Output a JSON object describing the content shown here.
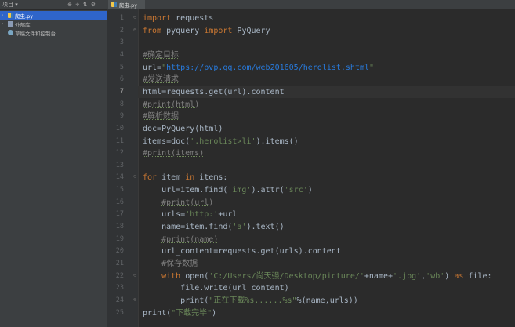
{
  "sidebar": {
    "toolbar_title": "项目 ▾",
    "toolbar_icons": [
      "⊕",
      "≑",
      "⇅",
      "⚙",
      "—"
    ],
    "items": [
      {
        "arrow": "›",
        "label": "爬虫.py",
        "selected": true,
        "icon": "python-file-icon"
      },
      {
        "arrow": "›",
        "label": "外部库",
        "selected": false,
        "icon": "library-icon"
      },
      {
        "arrow": "",
        "label": "草稿文件和控制台",
        "selected": false,
        "icon": "scratch-icon"
      }
    ]
  },
  "editor": {
    "tab_label": "爬虫.py",
    "current_line": 7,
    "lines": [
      {
        "n": "1",
        "fold": "⊖",
        "tokens": [
          {
            "t": "kw",
            "v": "import"
          },
          {
            "t": "",
            "v": " requests"
          }
        ]
      },
      {
        "n": "2",
        "fold": "⊖",
        "tokens": [
          {
            "t": "kw",
            "v": "from"
          },
          {
            "t": "",
            "v": " pyquery "
          },
          {
            "t": "kw",
            "v": "import"
          },
          {
            "t": "",
            "v": " PyQuery"
          }
        ]
      },
      {
        "n": "3",
        "fold": "",
        "tokens": []
      },
      {
        "n": "4",
        "fold": "",
        "tokens": [
          {
            "t": "cm ul",
            "v": "#确定目标"
          }
        ]
      },
      {
        "n": "5",
        "fold": "",
        "tokens": [
          {
            "t": "",
            "v": "url="
          },
          {
            "t": "str",
            "v": "\""
          },
          {
            "t": "url",
            "v": "https://pvp.qq.com/web201605/herolist.shtml"
          },
          {
            "t": "str",
            "v": "\""
          }
        ]
      },
      {
        "n": "6",
        "fold": "",
        "tokens": [
          {
            "t": "cm ul",
            "v": "#发送请求"
          }
        ]
      },
      {
        "n": "7",
        "fold": "",
        "tokens": [
          {
            "t": "",
            "v": "html=requests.get(url).content"
          }
        ]
      },
      {
        "n": "8",
        "fold": "",
        "tokens": [
          {
            "t": "cm ul",
            "v": "#print(html)"
          }
        ]
      },
      {
        "n": "9",
        "fold": "",
        "tokens": [
          {
            "t": "cm ul",
            "v": "#解析数据"
          }
        ]
      },
      {
        "n": "10",
        "fold": "",
        "tokens": [
          {
            "t": "",
            "v": "doc=PyQuery(html)"
          }
        ]
      },
      {
        "n": "11",
        "fold": "",
        "tokens": [
          {
            "t": "",
            "v": "items=doc("
          },
          {
            "t": "str",
            "v": "'.herolist>li'"
          },
          {
            "t": "",
            "v": ").items()"
          }
        ]
      },
      {
        "n": "12",
        "fold": "",
        "tokens": [
          {
            "t": "cm ul",
            "v": "#print(items)"
          }
        ]
      },
      {
        "n": "13",
        "fold": "",
        "tokens": []
      },
      {
        "n": "14",
        "fold": "⊖",
        "tokens": [
          {
            "t": "kw",
            "v": "for"
          },
          {
            "t": "",
            "v": " item "
          },
          {
            "t": "kw",
            "v": "in"
          },
          {
            "t": "",
            "v": " items:"
          }
        ]
      },
      {
        "n": "15",
        "fold": "",
        "tokens": [
          {
            "t": "",
            "v": "    url=item.find("
          },
          {
            "t": "str",
            "v": "'img'"
          },
          {
            "t": "",
            "v": ").attr("
          },
          {
            "t": "str",
            "v": "'src'"
          },
          {
            "t": "",
            "v": ")"
          }
        ]
      },
      {
        "n": "16",
        "fold": "",
        "tokens": [
          {
            "t": "",
            "v": "    "
          },
          {
            "t": "cm ul",
            "v": "#print(url)"
          }
        ]
      },
      {
        "n": "17",
        "fold": "",
        "tokens": [
          {
            "t": "",
            "v": "    urls="
          },
          {
            "t": "str",
            "v": "'http:'"
          },
          {
            "t": "",
            "v": "+url"
          }
        ]
      },
      {
        "n": "18",
        "fold": "",
        "tokens": [
          {
            "t": "",
            "v": "    name=item.find("
          },
          {
            "t": "str",
            "v": "'a'"
          },
          {
            "t": "",
            "v": ").text()"
          }
        ]
      },
      {
        "n": "19",
        "fold": "",
        "tokens": [
          {
            "t": "",
            "v": "    "
          },
          {
            "t": "cm ul",
            "v": "#print(name)"
          }
        ]
      },
      {
        "n": "20",
        "fold": "",
        "tokens": [
          {
            "t": "",
            "v": "    url_content=requests.get(urls).content"
          }
        ]
      },
      {
        "n": "21",
        "fold": "",
        "tokens": [
          {
            "t": "",
            "v": "    "
          },
          {
            "t": "cm ul",
            "v": "#保存数据"
          }
        ]
      },
      {
        "n": "22",
        "fold": "⊖",
        "tokens": [
          {
            "t": "",
            "v": "    "
          },
          {
            "t": "kw",
            "v": "with"
          },
          {
            "t": "",
            "v": " open("
          },
          {
            "t": "str",
            "v": "'C:/Users/尚天强/Desktop/picture/'"
          },
          {
            "t": "",
            "v": "+name+"
          },
          {
            "t": "str",
            "v": "'.jpg'"
          },
          {
            "t": "",
            "v": ","
          },
          {
            "t": "str",
            "v": "'wb'"
          },
          {
            "t": "",
            "v": ") "
          },
          {
            "t": "kw",
            "v": "as"
          },
          {
            "t": "",
            "v": " file:"
          }
        ]
      },
      {
        "n": "23",
        "fold": "",
        "tokens": [
          {
            "t": "",
            "v": "        file.write(url_content)"
          }
        ]
      },
      {
        "n": "24",
        "fold": "⊖",
        "tokens": [
          {
            "t": "",
            "v": "        print("
          },
          {
            "t": "str",
            "v": "\"正在下载%s......%s\""
          },
          {
            "t": "",
            "v": "%(name,urls))"
          }
        ]
      },
      {
        "n": "25",
        "fold": "",
        "tokens": [
          {
            "t": "",
            "v": "print("
          },
          {
            "t": "str",
            "v": "\"下载完毕\""
          },
          {
            "t": "",
            "v": ")"
          }
        ]
      }
    ]
  }
}
